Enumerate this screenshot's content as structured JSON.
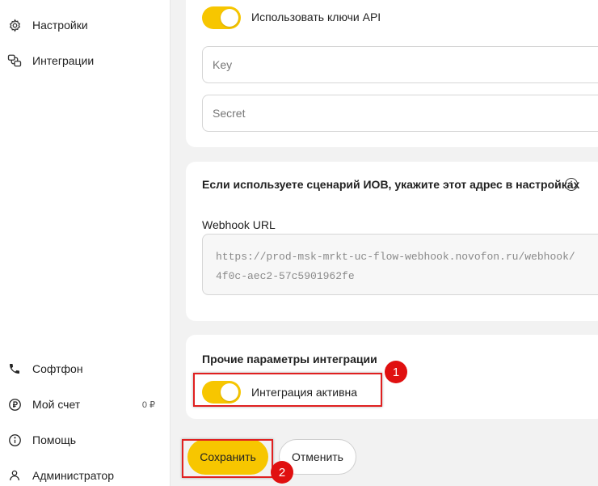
{
  "sidebar": {
    "top_items": [
      {
        "label": "Настройки",
        "icon": "gear-icon"
      },
      {
        "label": "Интеграции",
        "icon": "integrations-icon"
      }
    ],
    "bottom_items": [
      {
        "label": "Софтфон",
        "icon": "phone-icon"
      },
      {
        "label": "Мой счет",
        "icon": "ruble-icon",
        "balance": "0 ₽"
      },
      {
        "label": "Помощь",
        "icon": "info-icon"
      },
      {
        "label": "Администратор",
        "icon": "user-icon"
      }
    ]
  },
  "api_keys": {
    "toggle_label": "Использовать ключи API",
    "toggle_on": true,
    "key_placeholder": "Key",
    "secret_placeholder": "Secret"
  },
  "webhook": {
    "hint": "Если используете сценарий ИОВ, укажите этот адрес в настройках",
    "url_label": "Webhook URL",
    "url_line1": "https://prod-msk-mrkt-uc-flow-webhook.novofon.ru/webhook/",
    "url_line2": "4f0c-aec2-57c5901962fe"
  },
  "other_params": {
    "title": "Прочие параметры интеграции",
    "toggle_label": "Интеграция активна",
    "toggle_on": true
  },
  "actions": {
    "save_label": "Сохранить",
    "cancel_label": "Отменить"
  },
  "annotations": {
    "badge1": "1",
    "badge2": "2",
    "highlight_color": "#e02020"
  },
  "colors": {
    "accent": "#f7c600",
    "background": "#f2f2f2"
  }
}
